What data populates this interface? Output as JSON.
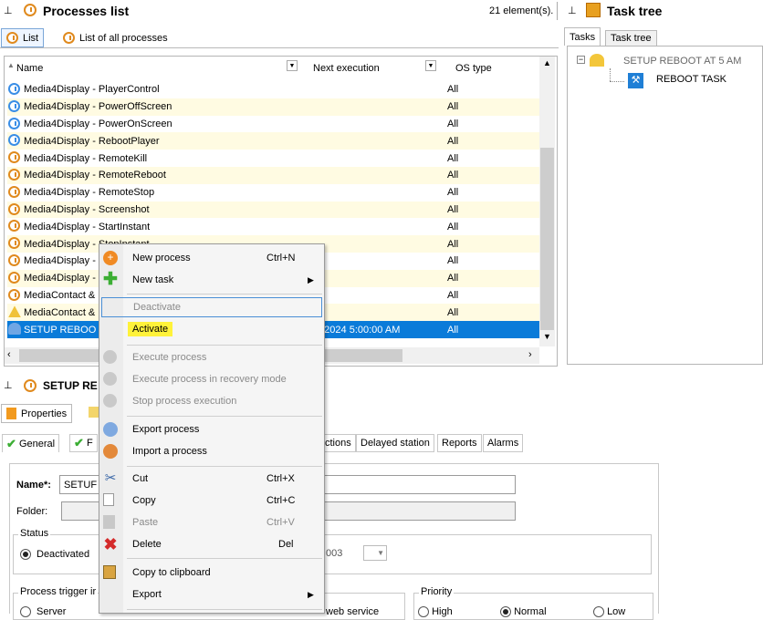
{
  "processes_pane": {
    "title": "Processes list",
    "count": "21 element(s).",
    "tabs": [
      "List",
      "List of all processes"
    ],
    "columns": [
      "Name",
      "Next execution",
      "OS type"
    ],
    "rows": [
      {
        "name": "Media4Display - PlayerControl",
        "next": "",
        "os": "All",
        "icon": "blue"
      },
      {
        "name": "Media4Display - PowerOffScreen",
        "next": "",
        "os": "All",
        "icon": "blue"
      },
      {
        "name": "Media4Display - PowerOnScreen",
        "next": "",
        "os": "All",
        "icon": "blue"
      },
      {
        "name": "Media4Display - RebootPlayer",
        "next": "",
        "os": "All",
        "icon": "blue"
      },
      {
        "name": "Media4Display - RemoteKill",
        "next": "",
        "os": "All",
        "icon": "orange"
      },
      {
        "name": "Media4Display - RemoteReboot",
        "next": "",
        "os": "All",
        "icon": "orange"
      },
      {
        "name": "Media4Display - RemoteStop",
        "next": "",
        "os": "All",
        "icon": "orange"
      },
      {
        "name": "Media4Display - Screenshot",
        "next": "",
        "os": "All",
        "icon": "orange"
      },
      {
        "name": "Media4Display - StartInstant",
        "next": "",
        "os": "All",
        "icon": "orange"
      },
      {
        "name": "Media4Display - StopInstant",
        "next": "",
        "os": "All",
        "icon": "orange"
      },
      {
        "name": "Media4Display -",
        "next": "",
        "os": "All",
        "icon": "orange"
      },
      {
        "name": "Media4Display -",
        "next": "",
        "os": "All",
        "icon": "orange"
      },
      {
        "name": "MediaContact &",
        "next": "",
        "os": "All",
        "icon": "orange"
      },
      {
        "name": "MediaContact &",
        "next": "",
        "os": "All",
        "icon": "warn"
      },
      {
        "name": "SETUP REBOO",
        "next": "3/2024 5:00:00 AM",
        "os": "All",
        "icon": "setup"
      }
    ]
  },
  "task_tree_pane": {
    "title": "Task tree",
    "tabs": [
      "Tasks",
      "Task tree"
    ],
    "root": "SETUP REBOOT AT 5 AM",
    "child": "REBOOT TASK"
  },
  "details_pane": {
    "title": "SETUP RE",
    "toolbar_tab": "Properties",
    "tabs": [
      "General",
      "F",
      "ctions",
      "Delayed station",
      "Reports",
      "Alarms"
    ],
    "name_label": "Name*:",
    "name_value": "SETUF",
    "folder_label": "Folder:",
    "status_label": "Status",
    "status_value": "Deactivated",
    "date_fragment": "003",
    "trigger_label": "Process trigger ir",
    "trigger_option": "Server",
    "web_service_fragment": "web service",
    "priority_label": "Priority",
    "priority_options": [
      "High",
      "Normal",
      "Low"
    ]
  },
  "context_menu": {
    "items": [
      {
        "label": "New process",
        "shortcut": "Ctrl+N",
        "icon": "new-process-icon",
        "enabled": true
      },
      {
        "label": "New task",
        "shortcut": "",
        "submenu": true,
        "icon": "new-task-icon",
        "enabled": true
      },
      {
        "label": "Deactivate",
        "shortcut": "",
        "enabled": false
      },
      {
        "label": "Activate",
        "shortcut": "",
        "enabled": true,
        "highlight": "#fff23a"
      },
      {
        "label": "Execute process",
        "enabled": false,
        "icon": "execute-icon"
      },
      {
        "label": "Execute process in recovery mode",
        "enabled": false,
        "icon": "recovery-icon"
      },
      {
        "label": "Stop process execution",
        "enabled": false,
        "icon": "stop-icon"
      },
      {
        "label": "Export process",
        "enabled": true,
        "icon": "export-process-icon"
      },
      {
        "label": "Import a process",
        "enabled": true,
        "icon": "import-process-icon"
      },
      {
        "label": "Cut",
        "shortcut": "Ctrl+X",
        "enabled": true,
        "icon": "scissors-icon"
      },
      {
        "label": "Copy",
        "shortcut": "Ctrl+C",
        "enabled": true,
        "icon": "copy-icon"
      },
      {
        "label": "Paste",
        "shortcut": "Ctrl+V",
        "enabled": false,
        "icon": "paste-icon"
      },
      {
        "label": "Delete",
        "shortcut": "Del",
        "enabled": true,
        "icon": "delete-icon"
      },
      {
        "label": "Copy to clipboard",
        "enabled": true,
        "icon": "clipboard-icon"
      },
      {
        "label": "Export",
        "submenu": true,
        "enabled": true
      }
    ]
  },
  "colors": {
    "selection": "#0a7bd9",
    "alt_row": "#fffbe2",
    "highlight": "#fff23a",
    "accent_orange": "#e08a1e"
  }
}
